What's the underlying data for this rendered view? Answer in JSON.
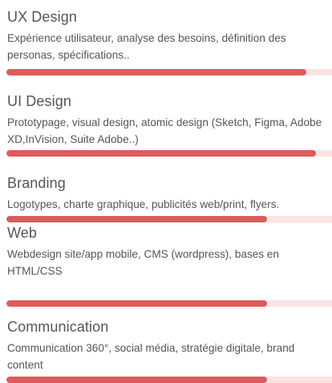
{
  "colors": {
    "accent": "#dc5b5b",
    "track": "#fbe3e3",
    "text": "#555555"
  },
  "skills": [
    {
      "title": "UX Design",
      "description": "Expérience utilisateur, analyse des besoins, définition des personas, spécifications..",
      "level": 0.92
    },
    {
      "title": "UI Design",
      "description": "Prototypage, visual design, atomic design (Sketch, Figma, Adobe XD,InVision, Suite Adobe..)",
      "level": 0.95
    },
    {
      "title": "Branding",
      "description": "Logotypes, charte graphique, publicités web/print, flyers.",
      "level": 0.8
    },
    {
      "title": "Web",
      "description": "Webdesign site/app mobile, CMS (wordpress), bases en HTML/CSS",
      "level": 0.8
    },
    {
      "title": "Communication",
      "description": "Communication 360°, social média, stratégie digitale, brand content",
      "level": 0.8
    }
  ]
}
